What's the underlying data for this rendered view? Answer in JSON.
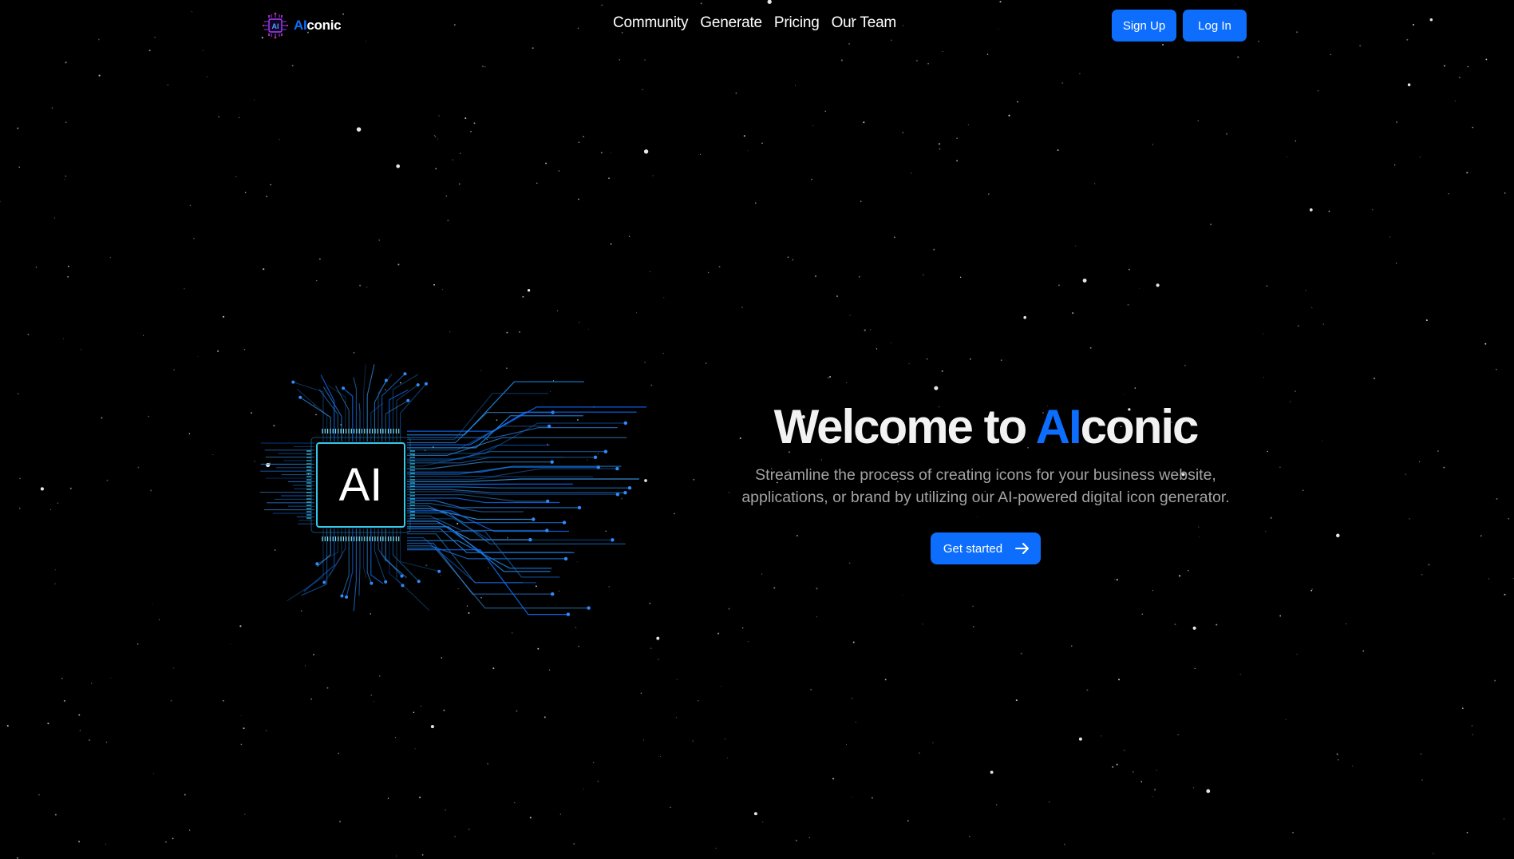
{
  "brand": {
    "name_accent": "AI",
    "name_rest": "conic"
  },
  "nav": {
    "links": [
      "Community",
      "Generate",
      "Pricing",
      "Our Team"
    ]
  },
  "auth": {
    "signup_label": "Sign Up",
    "login_label": "Log In"
  },
  "hero": {
    "title_prefix": "Welcome to ",
    "title_accent": "AI",
    "title_suffix": "conic",
    "subtitle": "Streamline the process of creating icons for your business website, applications, or brand by utilizing our AI-powered digital icon generator.",
    "cta_label": "Get started",
    "chip_text": "AI"
  },
  "colors": {
    "background": "#000000",
    "accent": "#0d6efd",
    "chip_glow": "#35c8e8"
  },
  "icons": {
    "logo": "ai-chip-logo-icon",
    "cta": "arrow-right-icon"
  }
}
